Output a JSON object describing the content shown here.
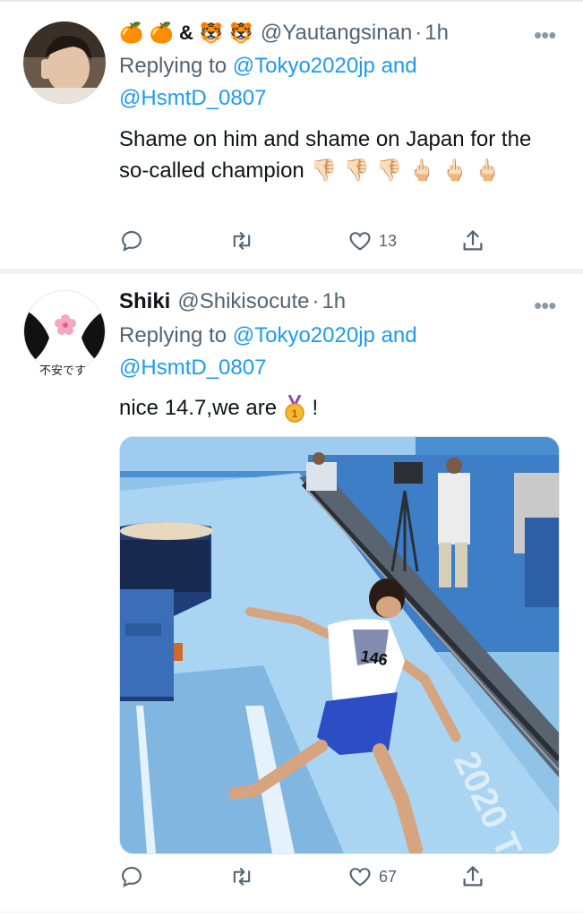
{
  "tweets": [
    {
      "name_emoji": "🍊 🍊 & 🐯 🐯",
      "handle": "@Yautangsinan",
      "dot": "·",
      "time": "1h",
      "replying_label": "Replying to",
      "replying_mention1": "@Tokyo2020jp",
      "replying_and": "and",
      "replying_mention2": "@HsmtD_0807",
      "text": "Shame on him and shame on Japan for the so-called champion",
      "text_emoji": "👎🏻 👎🏻 👎🏻 🖕🏻 🖕🏻 🖕🏻",
      "counts": {
        "reply": "",
        "retweet": "",
        "like": "13"
      }
    },
    {
      "name": "Shiki",
      "handle": "@Shikisocute",
      "dot": "·",
      "time": "1h",
      "avatar_caption": "不安です",
      "replying_label": "Replying to",
      "replying_mention1": "@Tokyo2020jp",
      "replying_and": "and",
      "replying_mention2": "@HsmtD_0807",
      "text": "nice 14.7,we are",
      "text_end": "!",
      "media": {
        "bib_number": "146",
        "mat_text": "2020 T"
      },
      "counts": {
        "reply": "",
        "retweet": "",
        "like": "67"
      }
    }
  ],
  "colors": {
    "accent": "#1d9bf0",
    "secondary_text": "#536471",
    "primary_text": "#0f1419"
  },
  "icons": [
    "more-icon",
    "reply-icon",
    "retweet-icon",
    "like-icon",
    "share-icon",
    "medal-icon"
  ]
}
